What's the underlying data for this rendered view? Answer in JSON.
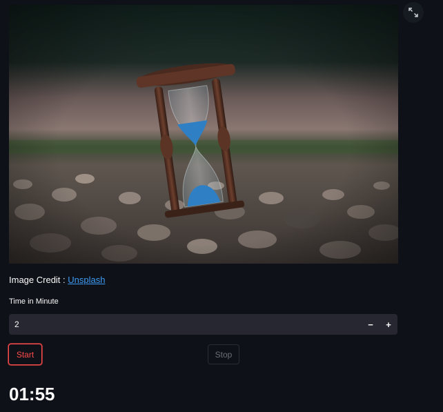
{
  "hero_image": {
    "subject": "hourglass-on-pebbles-photo"
  },
  "fullscreen": {
    "icon": "expand-icon"
  },
  "credit": {
    "prefix": "Image Credit : ",
    "link_text": "Unsplash",
    "link_color": "#3d9cf5"
  },
  "time_input": {
    "label": "Time in Minute",
    "value": "2",
    "decrement": "−",
    "increment": "+"
  },
  "buttons": {
    "start_label": "Start",
    "stop_label": "Stop",
    "start_color": "#ff4b4b"
  },
  "timer": {
    "display": "01:55"
  },
  "theme": {
    "background": "#0e1117",
    "input_background": "#262730"
  }
}
